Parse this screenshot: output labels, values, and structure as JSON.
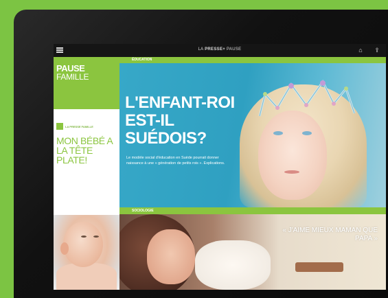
{
  "app": {
    "title_prefix": "LA",
    "title_brand": "PRESSE+",
    "title_suffix": "PAUSE"
  },
  "sidebar": {
    "title": "PAUSE",
    "subtitle": "FAMILLE",
    "promo_tag": "LA PRESSE FAMILLE",
    "promo_headline": "MON BÉBÉ A LA TÊTE PLATE!"
  },
  "hero": {
    "tag": "ÉDUCATION",
    "title": "L'ENFANT-ROI EST-IL SUÉDOIS?",
    "lede": "Le modèle social d'éducation en Suède pourrait donner naissance à une « génération de petits rois ». Explications."
  },
  "bottom": {
    "tag": "SOCIOLOGIE",
    "quote": "« J'AIME MIEUX MAMAN QUE PAPA »"
  },
  "colors": {
    "brand_green": "#8bc53f",
    "background": "#7cc443",
    "hero_blue": "#37a8c8"
  }
}
